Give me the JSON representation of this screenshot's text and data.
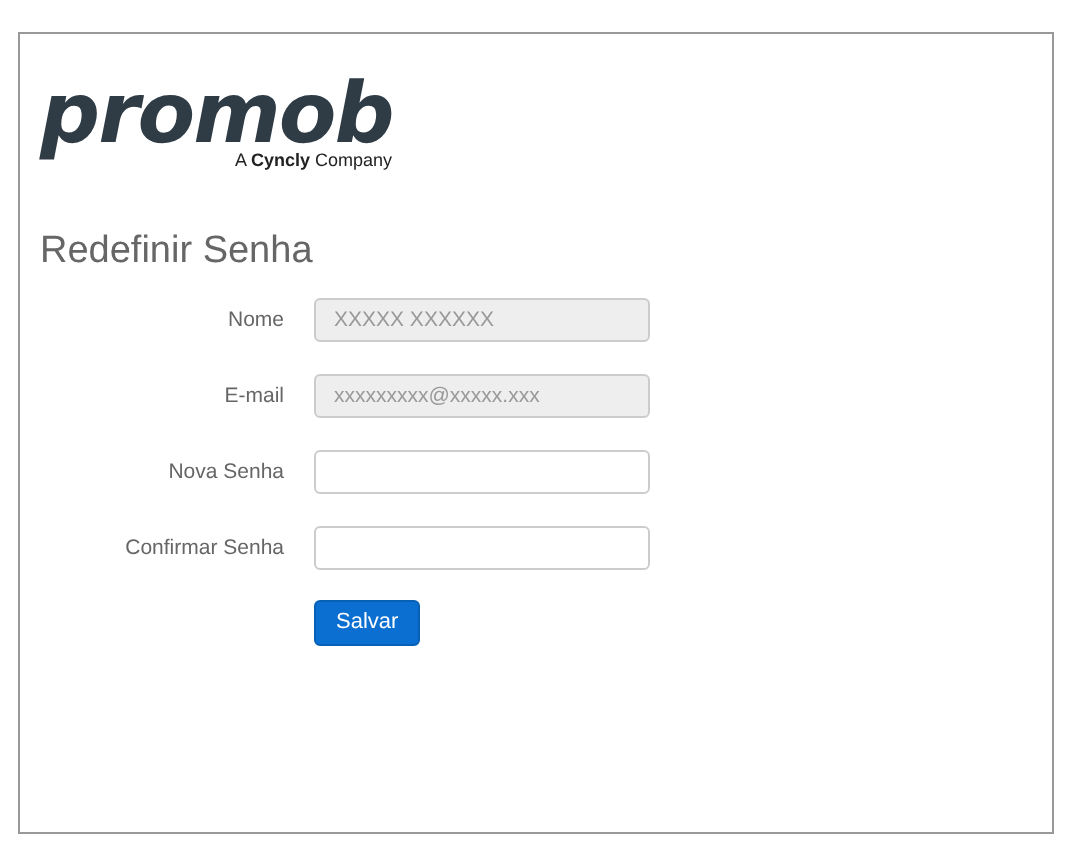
{
  "logo": {
    "name": "promob",
    "tagline": "A **Cyncly** Company"
  },
  "title": "Redefinir Senha",
  "fields": [
    {
      "label": "Nome",
      "value": "XXXXX XXXXXX",
      "disabled": true
    },
    {
      "label": "E-mail",
      "value": "xxxxxxxxx@xxxxx.xxx",
      "disabled": true
    },
    {
      "label": "Nova Senha",
      "disabled": false
    },
    {
      "label": "Confirmar Senha",
      "disabled": false
    }
  ],
  "button": "Salvar"
}
